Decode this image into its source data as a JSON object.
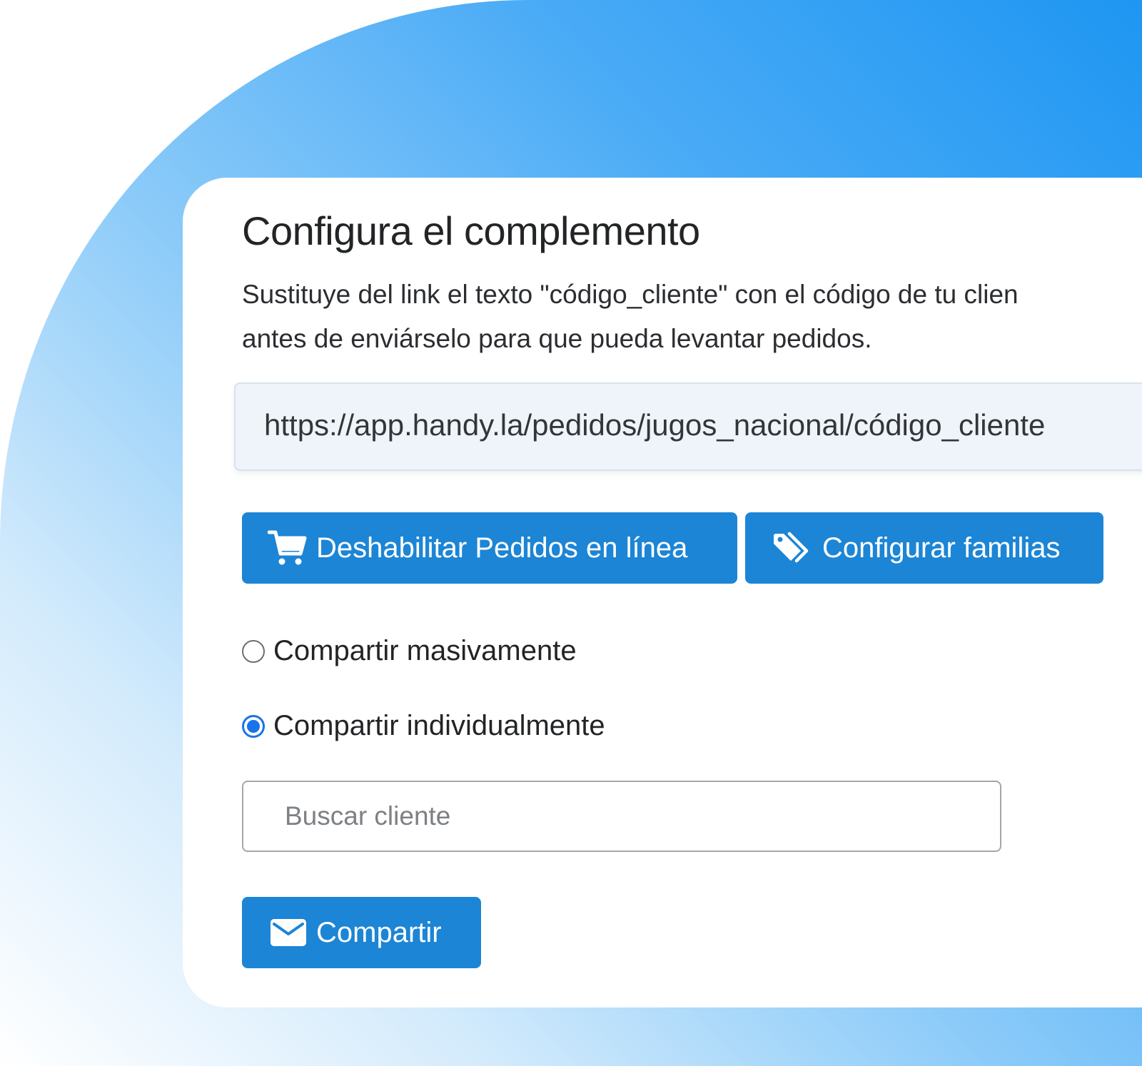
{
  "config": {
    "title": "Configura el complemento",
    "description_line1": "Sustituye del link el texto \"código_cliente\" con el código de tu clien",
    "description_line2": "antes de enviárselo para que pueda levantar pedidos.",
    "url": "https://app.handy.la/pedidos/jugos_nacional/código_cliente",
    "buttons": {
      "disable_orders": "Deshabilitar Pedidos en línea",
      "configure_families": "Configurar familias",
      "share": "Compartir"
    },
    "share_mode": {
      "options": [
        {
          "label": "Compartir masivamente",
          "selected": false
        },
        {
          "label": "Compartir individualmente",
          "selected": true
        }
      ]
    },
    "search": {
      "placeholder": "Buscar cliente",
      "value": ""
    }
  },
  "colors": {
    "button_bg": "#1c85d5",
    "radio_checked": "#1a73e8",
    "background_gradient_start": "#1e96f2",
    "url_box_bg": "#eef4f9"
  },
  "icons": {
    "disable_orders": "cart-icon",
    "configure_families": "tags-icon",
    "share": "envelope-icon"
  }
}
